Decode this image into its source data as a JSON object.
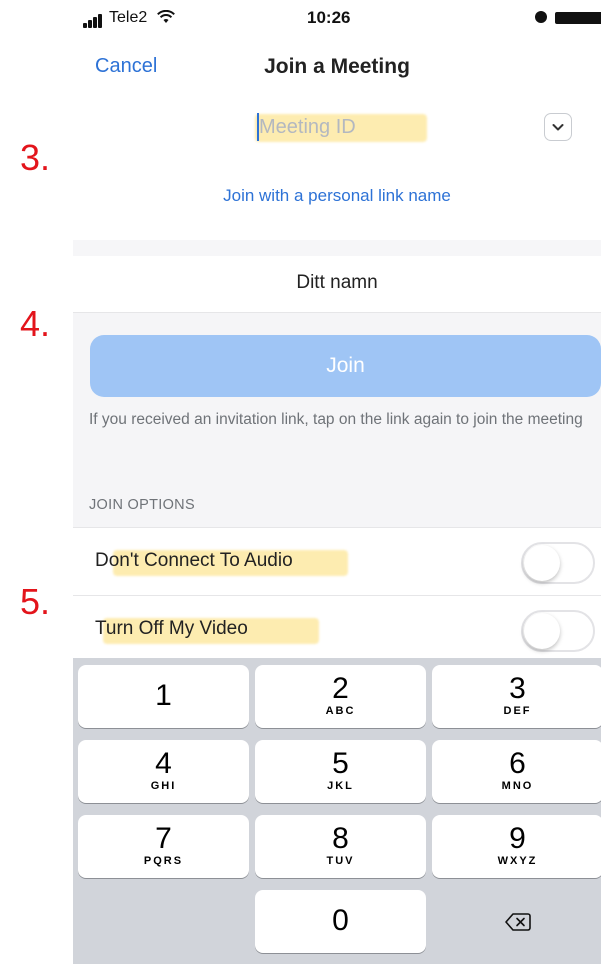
{
  "annotations": [
    "3.",
    "4.",
    "5."
  ],
  "status_bar": {
    "carrier": "Tele2",
    "time": "10:26"
  },
  "nav": {
    "cancel_label": "Cancel",
    "title": "Join a Meeting"
  },
  "meeting": {
    "id_placeholder": "Meeting ID",
    "personal_link_label": "Join with a personal link name",
    "name_value": "Ditt namn"
  },
  "join": {
    "button_label": "Join",
    "hint": "If you received an invitation link, tap on the link again to join the meeting"
  },
  "options": {
    "section_title": "JOIN OPTIONS",
    "items": [
      {
        "label": "Don't Connect To Audio",
        "enabled": false
      },
      {
        "label": "Turn Off My Video",
        "enabled": false
      }
    ]
  },
  "keypad": {
    "keys": [
      {
        "num": "1",
        "letters": ""
      },
      {
        "num": "2",
        "letters": "ABC"
      },
      {
        "num": "3",
        "letters": "DEF"
      },
      {
        "num": "4",
        "letters": "GHI"
      },
      {
        "num": "5",
        "letters": "JKL"
      },
      {
        "num": "6",
        "letters": "MNO"
      },
      {
        "num": "7",
        "letters": "PQRS"
      },
      {
        "num": "8",
        "letters": "TUV"
      },
      {
        "num": "9",
        "letters": "WXYZ"
      },
      {
        "num": "0",
        "letters": ""
      }
    ],
    "delete_icon": "backspace-icon"
  },
  "colors": {
    "accent": "#2d72d6",
    "join_button": "#9fc5f5",
    "highlight": "#fde9a3",
    "annotation": "#e3141b",
    "keypad_bg": "#d1d4da"
  }
}
